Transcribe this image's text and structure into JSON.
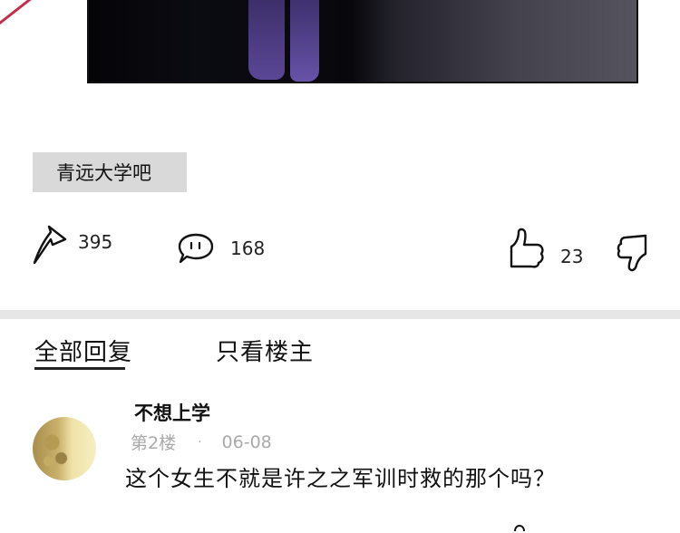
{
  "post": {
    "tag": "青远大学吧",
    "stats": {
      "shares": "395",
      "comments": "168",
      "likes": "23"
    }
  },
  "tabs": {
    "all_replies": "全部回复",
    "owner_only": "只看楼主",
    "active": "all_replies"
  },
  "reply": {
    "username": "不想上学",
    "floor": "第2楼",
    "separator": "·",
    "date": "06-08",
    "text": "这个女生不就是许之之军训时救的那个吗？"
  },
  "icons": {
    "share": "share-arrow-icon",
    "comment": "comment-bubble-icon",
    "like": "thumbs-up-icon",
    "dislike": "thumbs-down-icon"
  },
  "colors": {
    "tag_background": "#d9d9d9",
    "divider": "#e6e6e6",
    "meta_text": "#a9a9a9",
    "accent_stripe": "#c0304a"
  }
}
